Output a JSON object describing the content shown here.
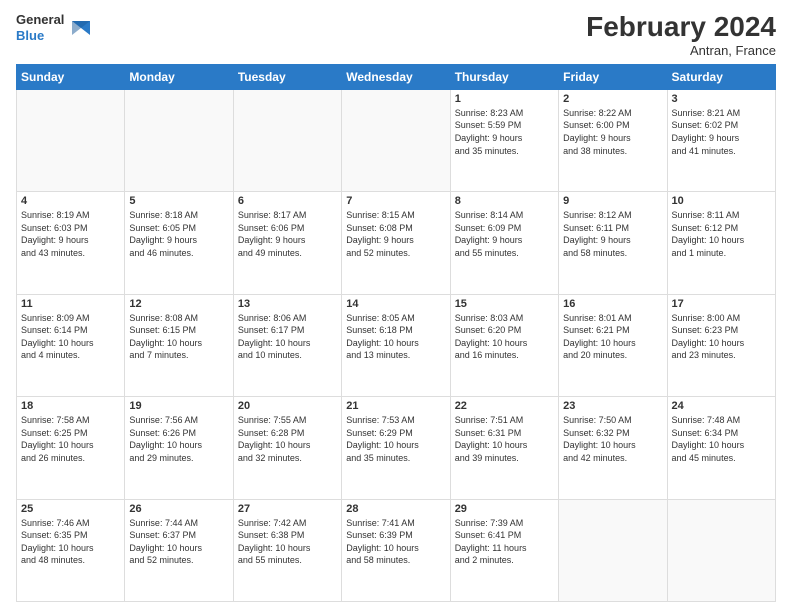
{
  "header": {
    "logo_line1": "General",
    "logo_line2": "Blue",
    "month_year": "February 2024",
    "location": "Antran, France"
  },
  "weekdays": [
    "Sunday",
    "Monday",
    "Tuesday",
    "Wednesday",
    "Thursday",
    "Friday",
    "Saturday"
  ],
  "weeks": [
    [
      {
        "day": "",
        "info": ""
      },
      {
        "day": "",
        "info": ""
      },
      {
        "day": "",
        "info": ""
      },
      {
        "day": "",
        "info": ""
      },
      {
        "day": "1",
        "info": "Sunrise: 8:23 AM\nSunset: 5:59 PM\nDaylight: 9 hours\nand 35 minutes."
      },
      {
        "day": "2",
        "info": "Sunrise: 8:22 AM\nSunset: 6:00 PM\nDaylight: 9 hours\nand 38 minutes."
      },
      {
        "day": "3",
        "info": "Sunrise: 8:21 AM\nSunset: 6:02 PM\nDaylight: 9 hours\nand 41 minutes."
      }
    ],
    [
      {
        "day": "4",
        "info": "Sunrise: 8:19 AM\nSunset: 6:03 PM\nDaylight: 9 hours\nand 43 minutes."
      },
      {
        "day": "5",
        "info": "Sunrise: 8:18 AM\nSunset: 6:05 PM\nDaylight: 9 hours\nand 46 minutes."
      },
      {
        "day": "6",
        "info": "Sunrise: 8:17 AM\nSunset: 6:06 PM\nDaylight: 9 hours\nand 49 minutes."
      },
      {
        "day": "7",
        "info": "Sunrise: 8:15 AM\nSunset: 6:08 PM\nDaylight: 9 hours\nand 52 minutes."
      },
      {
        "day": "8",
        "info": "Sunrise: 8:14 AM\nSunset: 6:09 PM\nDaylight: 9 hours\nand 55 minutes."
      },
      {
        "day": "9",
        "info": "Sunrise: 8:12 AM\nSunset: 6:11 PM\nDaylight: 9 hours\nand 58 minutes."
      },
      {
        "day": "10",
        "info": "Sunrise: 8:11 AM\nSunset: 6:12 PM\nDaylight: 10 hours\nand 1 minute."
      }
    ],
    [
      {
        "day": "11",
        "info": "Sunrise: 8:09 AM\nSunset: 6:14 PM\nDaylight: 10 hours\nand 4 minutes."
      },
      {
        "day": "12",
        "info": "Sunrise: 8:08 AM\nSunset: 6:15 PM\nDaylight: 10 hours\nand 7 minutes."
      },
      {
        "day": "13",
        "info": "Sunrise: 8:06 AM\nSunset: 6:17 PM\nDaylight: 10 hours\nand 10 minutes."
      },
      {
        "day": "14",
        "info": "Sunrise: 8:05 AM\nSunset: 6:18 PM\nDaylight: 10 hours\nand 13 minutes."
      },
      {
        "day": "15",
        "info": "Sunrise: 8:03 AM\nSunset: 6:20 PM\nDaylight: 10 hours\nand 16 minutes."
      },
      {
        "day": "16",
        "info": "Sunrise: 8:01 AM\nSunset: 6:21 PM\nDaylight: 10 hours\nand 20 minutes."
      },
      {
        "day": "17",
        "info": "Sunrise: 8:00 AM\nSunset: 6:23 PM\nDaylight: 10 hours\nand 23 minutes."
      }
    ],
    [
      {
        "day": "18",
        "info": "Sunrise: 7:58 AM\nSunset: 6:25 PM\nDaylight: 10 hours\nand 26 minutes."
      },
      {
        "day": "19",
        "info": "Sunrise: 7:56 AM\nSunset: 6:26 PM\nDaylight: 10 hours\nand 29 minutes."
      },
      {
        "day": "20",
        "info": "Sunrise: 7:55 AM\nSunset: 6:28 PM\nDaylight: 10 hours\nand 32 minutes."
      },
      {
        "day": "21",
        "info": "Sunrise: 7:53 AM\nSunset: 6:29 PM\nDaylight: 10 hours\nand 35 minutes."
      },
      {
        "day": "22",
        "info": "Sunrise: 7:51 AM\nSunset: 6:31 PM\nDaylight: 10 hours\nand 39 minutes."
      },
      {
        "day": "23",
        "info": "Sunrise: 7:50 AM\nSunset: 6:32 PM\nDaylight: 10 hours\nand 42 minutes."
      },
      {
        "day": "24",
        "info": "Sunrise: 7:48 AM\nSunset: 6:34 PM\nDaylight: 10 hours\nand 45 minutes."
      }
    ],
    [
      {
        "day": "25",
        "info": "Sunrise: 7:46 AM\nSunset: 6:35 PM\nDaylight: 10 hours\nand 48 minutes."
      },
      {
        "day": "26",
        "info": "Sunrise: 7:44 AM\nSunset: 6:37 PM\nDaylight: 10 hours\nand 52 minutes."
      },
      {
        "day": "27",
        "info": "Sunrise: 7:42 AM\nSunset: 6:38 PM\nDaylight: 10 hours\nand 55 minutes."
      },
      {
        "day": "28",
        "info": "Sunrise: 7:41 AM\nSunset: 6:39 PM\nDaylight: 10 hours\nand 58 minutes."
      },
      {
        "day": "29",
        "info": "Sunrise: 7:39 AM\nSunset: 6:41 PM\nDaylight: 11 hours\nand 2 minutes."
      },
      {
        "day": "",
        "info": ""
      },
      {
        "day": "",
        "info": ""
      }
    ]
  ]
}
